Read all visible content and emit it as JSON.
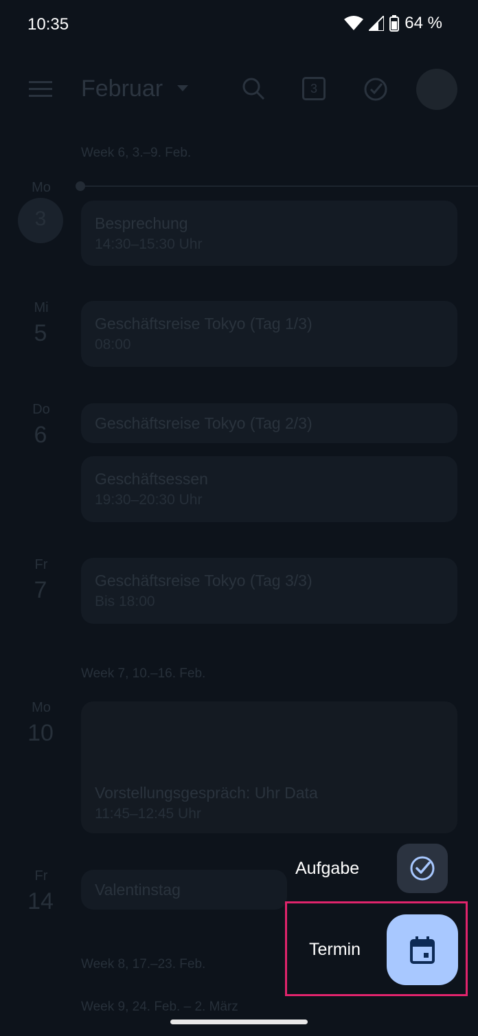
{
  "status": {
    "time": "10:35",
    "battery": "64 %"
  },
  "header": {
    "month": "Februar",
    "today_badge": "3"
  },
  "weeks": [
    {
      "label": "Week 6, 3.–9. Feb."
    },
    {
      "label": "Week 7, 10.–16. Feb."
    },
    {
      "label": "Week 8, 17.–23. Feb."
    },
    {
      "label": "Week 9, 24. Feb. – 2. März"
    }
  ],
  "days": [
    {
      "name": "Mo",
      "num": "3"
    },
    {
      "name": "Mi",
      "num": "5"
    },
    {
      "name": "Do",
      "num": "6"
    },
    {
      "name": "Fr",
      "num": "7"
    },
    {
      "name": "Mo",
      "num": "10"
    },
    {
      "name": "Fr",
      "num": "14"
    }
  ],
  "events": [
    {
      "title": "Besprechung",
      "time": "14:30–15:30 Uhr"
    },
    {
      "title": "Geschäftsreise Tokyo (Tag 1/3)",
      "time": "08:00"
    },
    {
      "title": "Geschäftsreise Tokyo (Tag 2/3)"
    },
    {
      "title": "Geschäftsessen",
      "time": "19:30–20:30 Uhr"
    },
    {
      "title": "Geschäftsreise Tokyo (Tag 3/3)",
      "time": "Bis 18:00"
    },
    {
      "title": "Vorstellungsgespräch: Uhr Data",
      "time": "11:45–12:45 Uhr"
    },
    {
      "title": "Valentinstag"
    }
  ],
  "fab_menu": {
    "task_label": "Aufgabe",
    "event_label": "Termin"
  }
}
